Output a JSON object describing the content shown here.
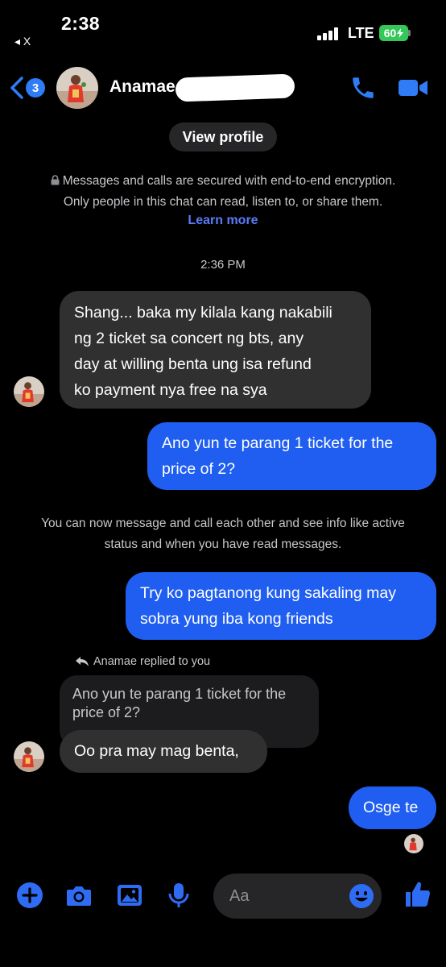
{
  "status_bar": {
    "time": "2:38",
    "back_app": "◂ X",
    "network": "LTE",
    "battery": "60"
  },
  "header": {
    "unread_count": "3",
    "contact_name": "Anamae"
  },
  "view_profile": "View profile",
  "encryption_notice": {
    "line1": "Messages and calls are secured with end-to-end encryption.",
    "line2": "Only people in this chat can read, listen to, or share them.",
    "learn_more": "Learn more"
  },
  "timestamp": "2:36 PM",
  "messages": [
    {
      "direction": "incoming",
      "lines": [
        "Shang... baka my kilala kang nakabili",
        "ng 2 ticket sa concert ng bts, any",
        "day at willing benta ung isa refund",
        "ko payment nya free na sya"
      ]
    },
    {
      "direction": "outgoing",
      "lines": [
        "Ano yun te parang 1 ticket for the",
        "price of 2?"
      ]
    },
    {
      "direction": "outgoing",
      "lines": [
        "Try ko pagtanong kung sakaling may",
        "sobra yung iba kong friends"
      ]
    },
    {
      "direction": "incoming",
      "lines": [
        "Oo pra may mag benta,"
      ]
    },
    {
      "direction": "outgoing",
      "lines": [
        "Osge te"
      ]
    }
  ],
  "system_note": {
    "line1": "You can now message and call each other and see info like active",
    "line2": "status and when you have read messages."
  },
  "reply": {
    "label": "Anamae replied to you",
    "quoted_lines": [
      "Ano yun te parang 1 ticket for the",
      "price of 2?"
    ]
  },
  "composer": {
    "placeholder": "Aa"
  },
  "colors": {
    "accent": "#1f5ef0",
    "incoming_bubble": "#303030",
    "background": "#000000",
    "link": "#5b7bf7"
  }
}
